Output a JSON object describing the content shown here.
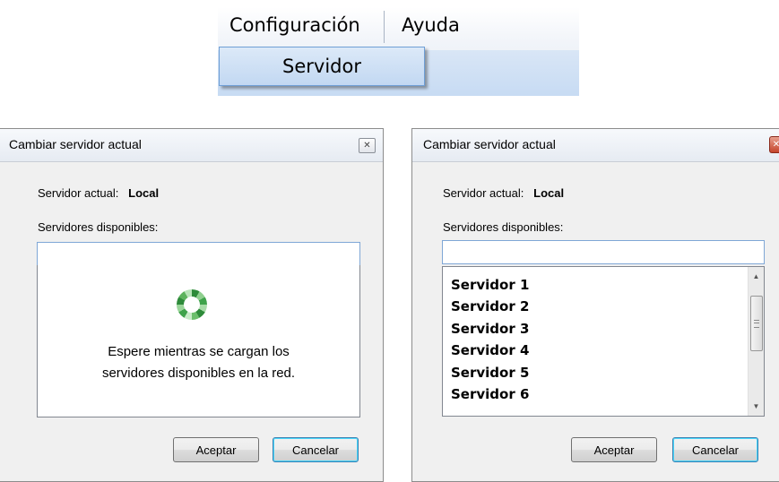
{
  "menu": {
    "configuracion_label": "Configuración",
    "ayuda_label": "Ayuda",
    "submenu": {
      "servidor_label": "Servidor"
    }
  },
  "dialog_loading": {
    "title": "Cambiar servidor actual",
    "current_server_label": "Servidor actual:",
    "current_server_value": "Local",
    "available_label": "Servidores disponibles:",
    "search_value": "",
    "loading_message": "Espere mientras se cargan los\nservidores disponibles en la red.",
    "accept_label": "Aceptar",
    "cancel_label": "Cancelar",
    "close_icon": "close-icon"
  },
  "dialog_loaded": {
    "title": "Cambiar servidor actual",
    "current_server_label": "Servidor actual:",
    "current_server_value": "Local",
    "available_label": "Servidores disponibles:",
    "search_value": "",
    "servers": [
      "Servidor 1",
      "Servidor 2",
      "Servidor 3",
      "Servidor 4",
      "Servidor 5",
      "Servidor 6"
    ],
    "accept_label": "Aceptar",
    "cancel_label": "Cancelar",
    "close_icon": "close-icon"
  },
  "colors": {
    "accent_border": "#7fa7d6",
    "menu_highlight": "#c2d8f2",
    "spinner_green": "#2e8b3a",
    "close_active_red": "#c5442b"
  }
}
